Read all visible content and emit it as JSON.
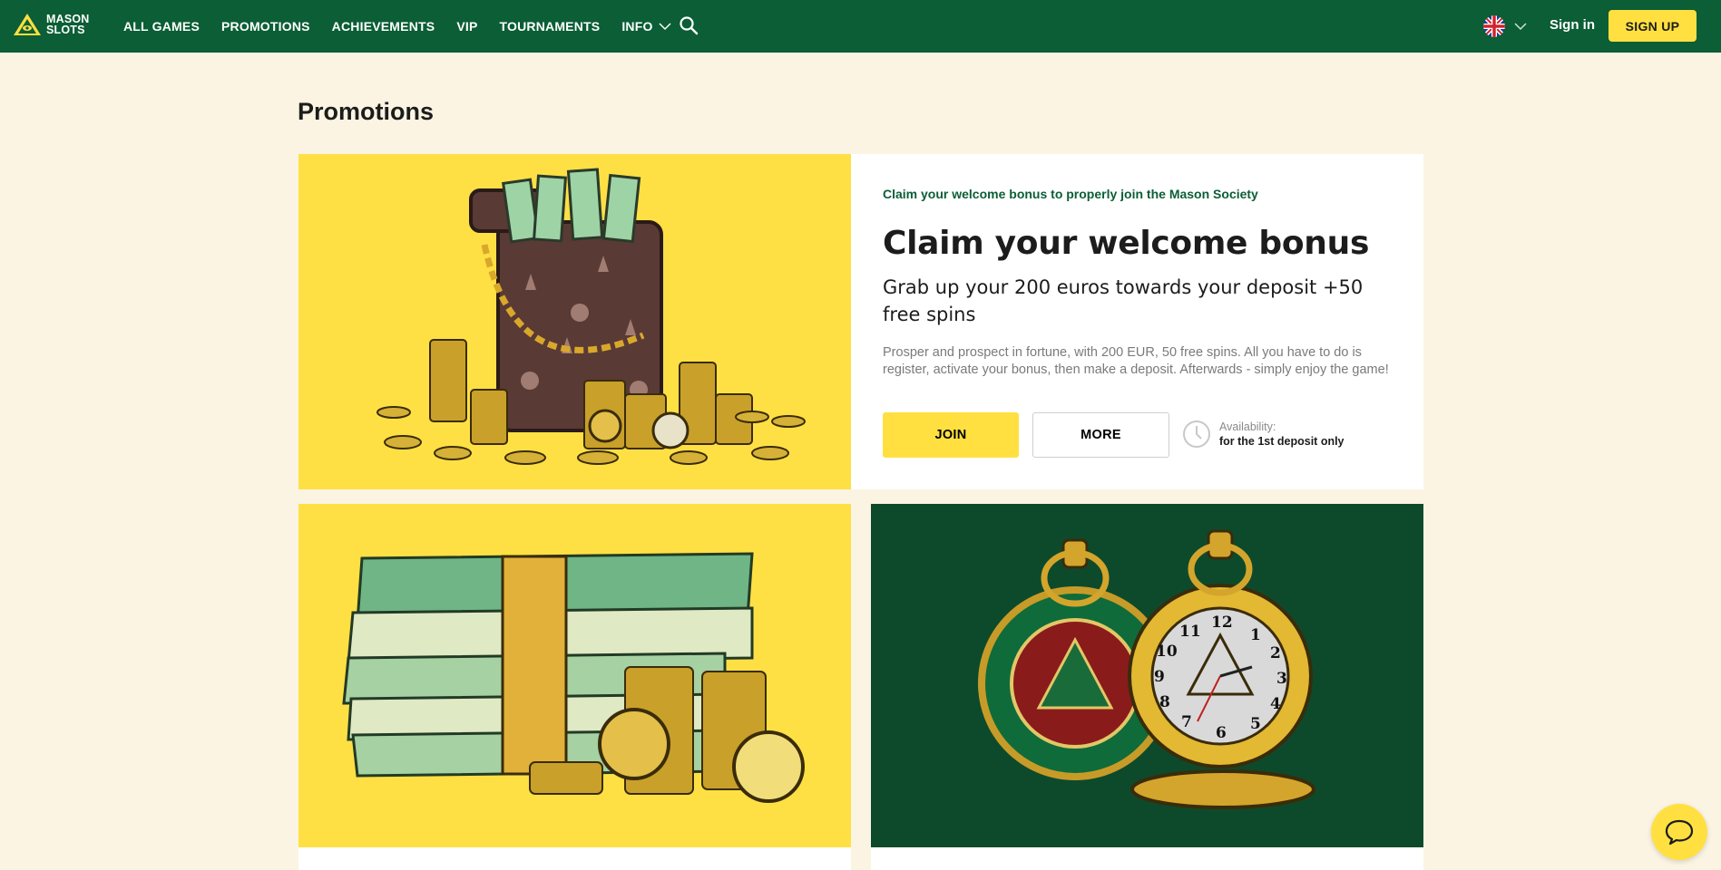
{
  "brand": {
    "logo_line1": "MASON",
    "logo_line2": "SLOTS"
  },
  "nav": {
    "items": [
      {
        "label": "ALL GAMES"
      },
      {
        "label": "PROMOTIONS"
      },
      {
        "label": "ACHIEVEMENTS"
      },
      {
        "label": "VIP"
      },
      {
        "label": "TOURNAMENTS"
      },
      {
        "label": "INFO"
      }
    ],
    "search_icon": "search-icon"
  },
  "header_right": {
    "language_icon": "uk-flag-icon",
    "signin_label": "Sign in",
    "signup_label": "SIGN UP"
  },
  "page": {
    "title": "Promotions"
  },
  "featured": {
    "kicker": "Claim your welcome bonus to properly join the Mason Society",
    "headline": "Claim your welcome bonus",
    "subhead": "Grab up your 200 euros towards your deposit +50 free spins",
    "description": "Prosper and prospect in fortune, with 200 EUR, 50 free spins. All you have to do is register, activate your bonus, then make a deposit. Afterwards - simply enjoy the game!",
    "join_label": "JOIN",
    "more_label": "MORE",
    "availability_label": "Availability:",
    "availability_value": "for the 1st deposit only",
    "image_icon": "money-bag-coins-illustration"
  },
  "cards": [
    {
      "image_icon": "cash-stack-coins-illustration"
    },
    {
      "image_icon": "pocket-watches-illustration"
    }
  ],
  "colors": {
    "header_bg": "#0b5e35",
    "accent_yellow": "#ffe040",
    "page_bg": "#fbf4e3",
    "dark_green": "#0d4a2b"
  },
  "chat_icon": "chat-bubble-icon"
}
